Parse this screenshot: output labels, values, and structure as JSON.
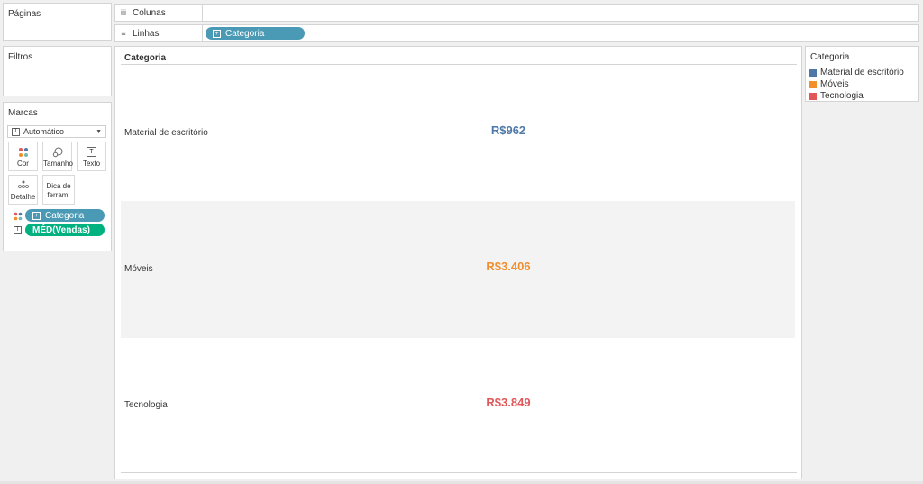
{
  "pages_panel": {
    "title": "Páginas"
  },
  "filters_panel": {
    "title": "Filtros"
  },
  "marks_panel": {
    "title": "Marcas",
    "mark_type": "Automático",
    "buttons": {
      "color": "Cor",
      "size": "Tamanho",
      "text": "Texto",
      "detail": "Detalhe",
      "tooltip_line1": "Dica de",
      "tooltip_line2": "ferram."
    },
    "pills": {
      "category": "Categoria",
      "measure": "MÉD(Vendas)"
    }
  },
  "shelves": {
    "columns_label": "Colunas",
    "rows_label": "Linhas",
    "rows_pill": "Categoria"
  },
  "view": {
    "header": "Categoria",
    "rows": [
      {
        "category": "Material de escritório",
        "value": "R$962",
        "color": "#4e79a7"
      },
      {
        "category": "Móveis",
        "value": "R$3.406",
        "color": "#f28e2b"
      },
      {
        "category": "Tecnologia",
        "value": "R$3.849",
        "color": "#e15759"
      }
    ]
  },
  "legend": {
    "title": "Categoria",
    "items": [
      {
        "label": "Material de escritório",
        "color": "#4e79a7"
      },
      {
        "label": "Móveis",
        "color": "#f28e2b"
      },
      {
        "label": "Tecnologia",
        "color": "#e15759"
      }
    ]
  },
  "colors": {
    "dimension_pill": "#4b9ab5",
    "measure_pill": "#00b180",
    "band": "#f3f3f3"
  }
}
